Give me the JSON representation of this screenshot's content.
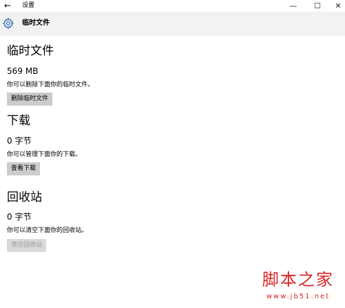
{
  "window": {
    "title": "设置",
    "back_icon": "back-arrow-icon",
    "minimize_icon": "minimize-icon",
    "maximize_icon": "maximize-icon",
    "close_icon": "close-icon"
  },
  "header": {
    "icon": "gear-icon",
    "title": "临时文件",
    "accent_color": "#2b6cb0"
  },
  "sections": [
    {
      "title": "临时文件",
      "size": "569 MB",
      "description": "你可以删除下面你的临时文件。",
      "button": "删除临时文件",
      "button_enabled": true
    },
    {
      "title": "下载",
      "size": "0 字节",
      "description": "你可以管理下面你的下载。",
      "button": "查看下载",
      "button_enabled": true
    },
    {
      "title": "回收站",
      "size": "0 字节",
      "description": "你可以清空下面你的回收站。",
      "button": "清空回收站",
      "button_enabled": false
    }
  ],
  "watermark": {
    "text": "脚本之家",
    "url": "www.jb51.net",
    "color": "#d8262b"
  }
}
